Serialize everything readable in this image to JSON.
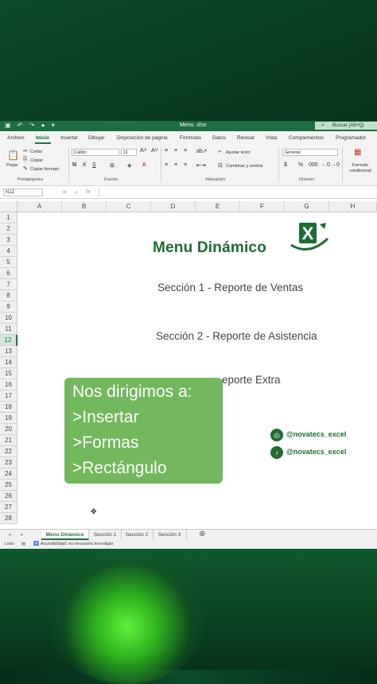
{
  "window": {
    "title": "Menu .xlsx",
    "search_label": "Buscar (Alt+Q)"
  },
  "menu_tabs": [
    "Archivo",
    "Inicio",
    "Insertar",
    "Dibujar",
    "Disposición de página",
    "Fórmulas",
    "Datos",
    "Revisar",
    "Vista",
    "Complementos",
    "Programador"
  ],
  "active_tab": "Inicio",
  "ribbon": {
    "paste": "Pegar",
    "cut": "Cortar",
    "copy": "Copiar",
    "format_painter": "Copiar formato",
    "group_clipboard": "Portapapeles",
    "font_name": "Calibri",
    "font_size": "11",
    "group_font": "Fuente",
    "wrap_text": "Ajustar texto",
    "merge_center": "Combinar y centrar",
    "group_alignment": "Alineación",
    "number_format": "General",
    "group_number": "Número",
    "conditional_format": "Formato condicional"
  },
  "formula_bar": {
    "name_box": "N12",
    "fx": "fx"
  },
  "columns": [
    "A",
    "B",
    "C",
    "D",
    "E",
    "F",
    "G",
    "H"
  ],
  "rows": [
    "1",
    "2",
    "3",
    "4",
    "5",
    "6",
    "7",
    "8",
    "9",
    "10",
    "11",
    "12",
    "13",
    "14",
    "15",
    "16",
    "17",
    "18",
    "19",
    "20",
    "21",
    "22",
    "23",
    "24",
    "25",
    "26",
    "27",
    "28"
  ],
  "selected_row": "12",
  "sheet": {
    "title": "Menu Dinámico",
    "sections": [
      "Sección 1 - Reporte de Ventas",
      "Sección 2 - Reporte de Asistencia",
      "eporte Extra"
    ],
    "callout_lines": [
      "Nos dirigimos a:",
      ">Insertar",
      ">Formas",
      ">Rectángulo"
    ],
    "social": [
      {
        "icon": "instagram-icon",
        "handle": "@novatecs_excel"
      },
      {
        "icon": "tiktok-icon",
        "handle": "@novatecs_excel"
      }
    ]
  },
  "sheet_tabs": [
    "Menu Dinámico",
    "Sección 1",
    "Sección 2",
    "Sección 3"
  ],
  "status": {
    "ready": "Listo",
    "accessibility": "Accesibilidad: es necesario investigar"
  },
  "colors": {
    "excel_green": "#1e6e42",
    "brand_green": "#1e6b34",
    "callout_green": "#73b75d"
  }
}
